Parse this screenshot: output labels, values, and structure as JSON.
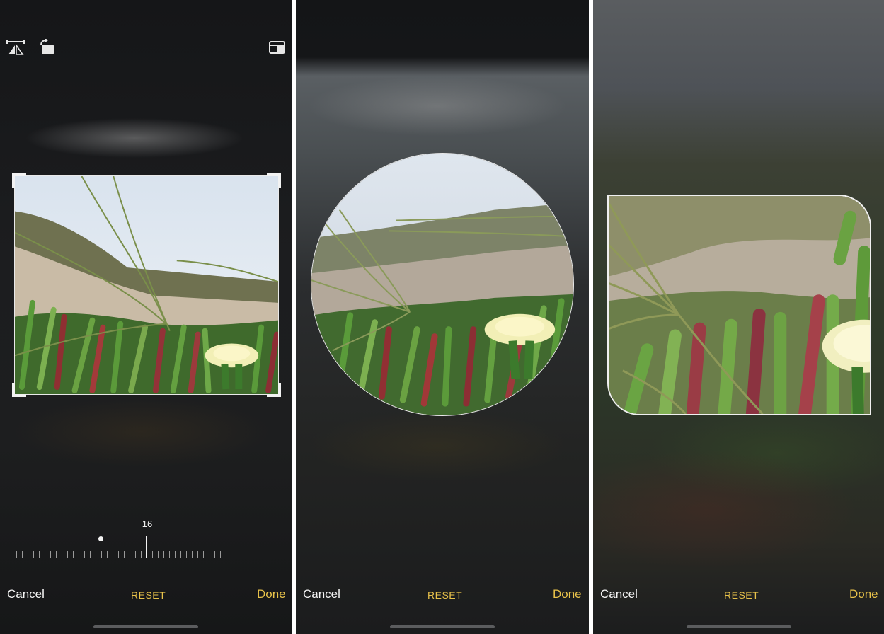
{
  "panels": [
    {
      "id": "crop-rectangle",
      "toolbar": {
        "left_icons": [
          "flip-horizontal-icon",
          "rotate-icon"
        ],
        "right_icon": "aspect-ratio-icon"
      },
      "dial": {
        "value": "16"
      },
      "bottom": {
        "cancel": "Cancel",
        "reset": "RESET",
        "done": "Done"
      }
    },
    {
      "id": "crop-circle",
      "bottom": {
        "cancel": "Cancel",
        "reset": "RESET",
        "done": "Done"
      }
    },
    {
      "id": "crop-rounded",
      "bottom": {
        "cancel": "Cancel",
        "reset": "RESET",
        "done": "Done"
      }
    }
  ],
  "colors": {
    "accent": "#e8c24a",
    "text": "#f4f4f4",
    "background": "#1c1d1f"
  }
}
